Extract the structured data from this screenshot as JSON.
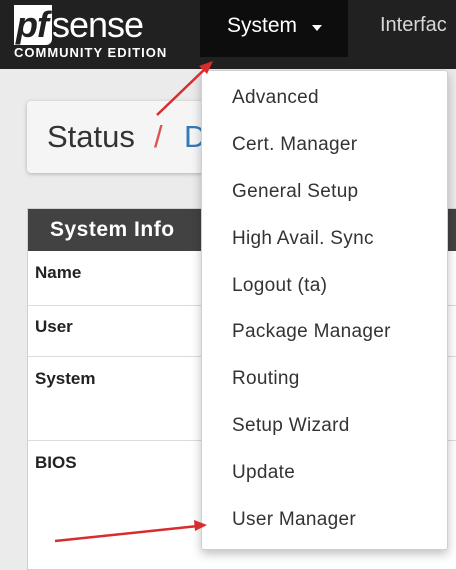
{
  "navbar": {
    "logo": {
      "pf": "pf",
      "sense": "sense",
      "edition": "COMMUNITY EDITION"
    },
    "system_label": "System",
    "interfaces_label": "Interfac"
  },
  "breadcrumb": {
    "status": "Status",
    "separator": "/",
    "next": "D"
  },
  "system_info": {
    "title": "System Info",
    "rows": [
      {
        "label": "Name"
      },
      {
        "label": "User"
      },
      {
        "label": "System"
      },
      {
        "label": "BIOS"
      }
    ]
  },
  "system_menu": {
    "items": [
      "Advanced",
      "Cert. Manager",
      "General Setup",
      "High Avail. Sync",
      "Logout (ta)",
      "Package Manager",
      "Routing",
      "Setup Wizard",
      "Update",
      "User Manager"
    ]
  },
  "annotation_color": "#d92d2d",
  "accent_link_color": "#337ab7",
  "separator_color": "#d9534f"
}
